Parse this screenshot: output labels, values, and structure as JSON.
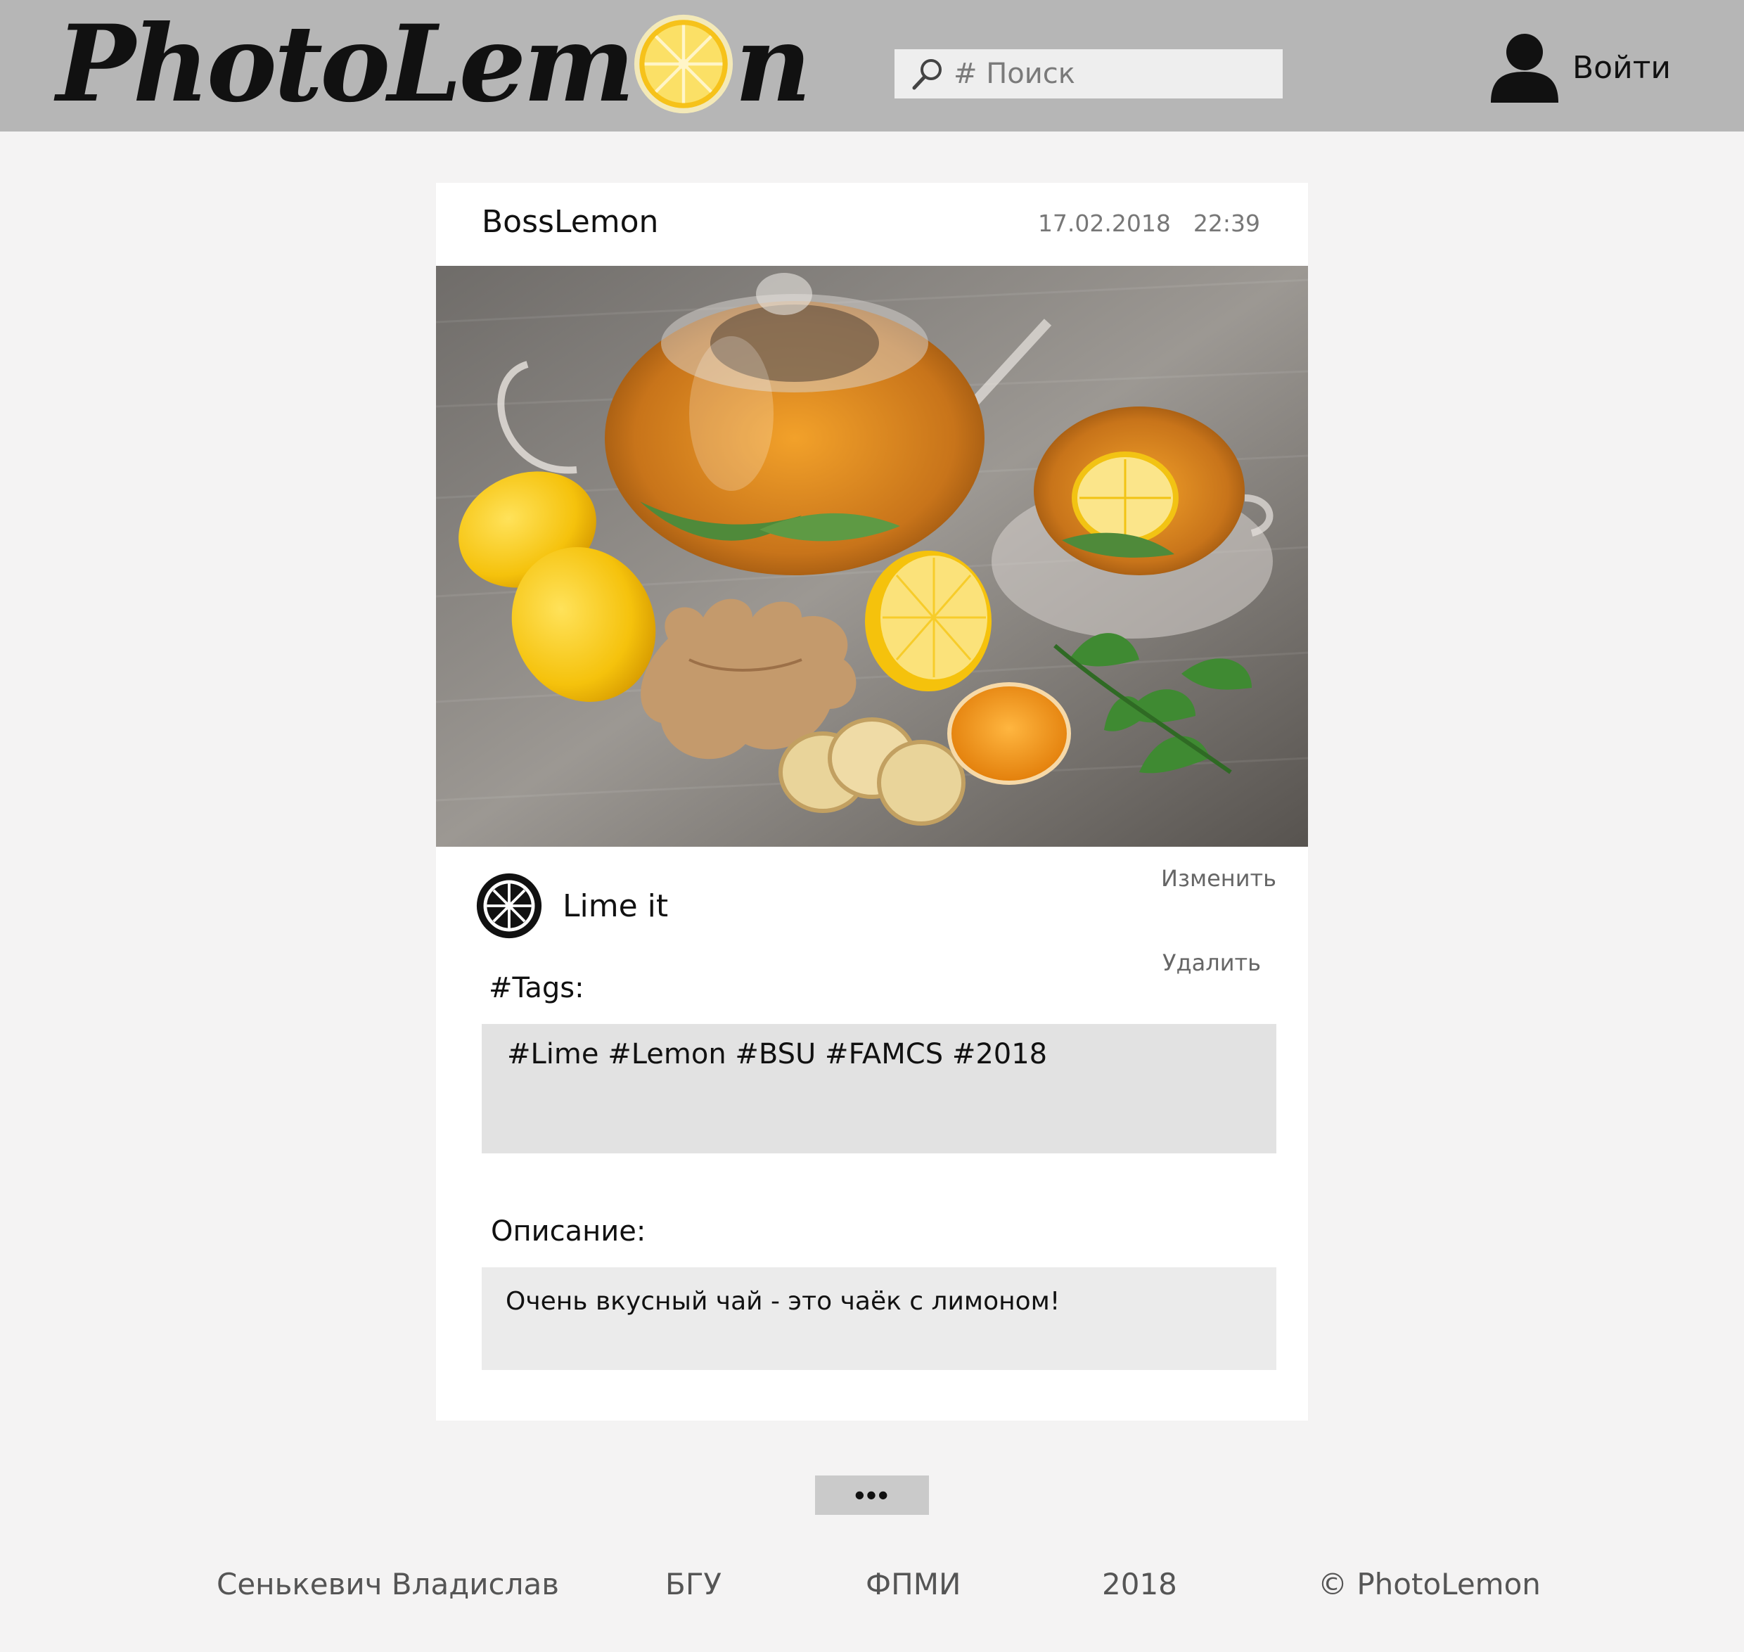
{
  "header": {
    "logo": {
      "text_before": "PhotoLem",
      "text_after": "n",
      "lemon_icon": "lemon-slice-icon"
    },
    "search": {
      "placeholder": "# Поиск",
      "icon": "search-icon"
    },
    "login": {
      "label": "Войти",
      "icon": "user-icon"
    }
  },
  "post": {
    "author": "BossLemon",
    "date": "17.02.2018",
    "time": "22:39",
    "lime_it": {
      "label": "Lime it",
      "icon": "lime-slice-icon"
    },
    "edit_label": "Изменить",
    "delete_label": "Удалить",
    "tags_label": "#Tags:",
    "tags": "#Lime #Lemon #BSU #FAMCS #2018",
    "description_label": "Описание:",
    "description": "Очень вкусный чай - это чаёк с лимоном!"
  },
  "more_label": "•••",
  "footer": [
    "Сенькевич Владислав",
    "БГУ",
    "ФПМИ",
    "2018",
    "© PhotoLemon"
  ],
  "colors": {
    "header_bg": "#b6b6b6",
    "page_bg": "#f4f3f3",
    "card_bg": "#ffffff",
    "tags_bg": "#e2e2e2",
    "desc_bg": "#ebebeb",
    "lemon": "#f6c21a"
  }
}
